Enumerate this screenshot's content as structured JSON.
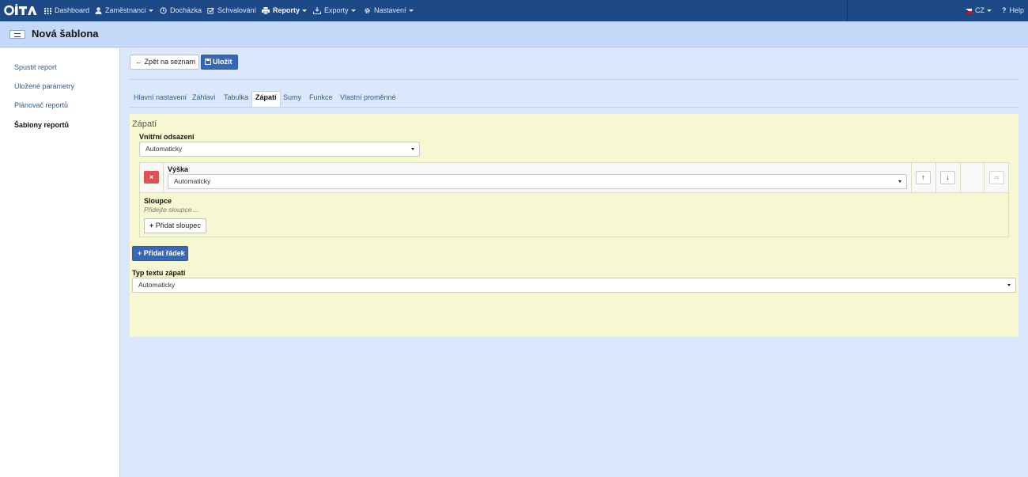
{
  "nav": {
    "logo": "iTA",
    "items": [
      {
        "label": "Dashboard"
      },
      {
        "label": "Zaměstnanci"
      },
      {
        "label": "Docházka"
      },
      {
        "label": "Schvalování"
      },
      {
        "label": "Reporty"
      },
      {
        "label": "Exporty"
      },
      {
        "label": "Nastavení"
      }
    ],
    "language": "CZ",
    "help": "Help"
  },
  "page": {
    "title": "Nová šablona"
  },
  "sidebar": {
    "items": [
      {
        "label": "Spustit report"
      },
      {
        "label": "Uložené parametry"
      },
      {
        "label": "Plánovač reportů"
      },
      {
        "label": "Šablony reportů"
      }
    ]
  },
  "toolbar": {
    "back_label": "Zpět na seznam",
    "save_label": "Uložit"
  },
  "tabs": [
    {
      "label": "Hlavní nastavení"
    },
    {
      "label": "Záhlaví"
    },
    {
      "label": "Tabulka"
    },
    {
      "label": "Zápatí"
    },
    {
      "label": "Sumy"
    },
    {
      "label": "Funkce"
    },
    {
      "label": "Vlastní proměnné"
    }
  ],
  "footer_panel": {
    "title": "Zápatí",
    "padding_label": "Vnitřní odsazení",
    "padding_value": "Automaticky",
    "row": {
      "delete_symbol": "×",
      "height_label": "Výška",
      "height_value": "Automaticky",
      "columns_label": "Sloupce",
      "columns_placeholder": "Přidejte sloupce ...",
      "add_column_label": "Přidat sloupec"
    },
    "add_row_label": "Přidat řádek",
    "text_type_label": "Typ textu zápatí",
    "text_type_value": "Automaticky"
  },
  "colors": {
    "navbar": "#1d4a86",
    "primary": "#3768b8",
    "danger": "#d9534f",
    "panel": "#f6f8d2"
  }
}
